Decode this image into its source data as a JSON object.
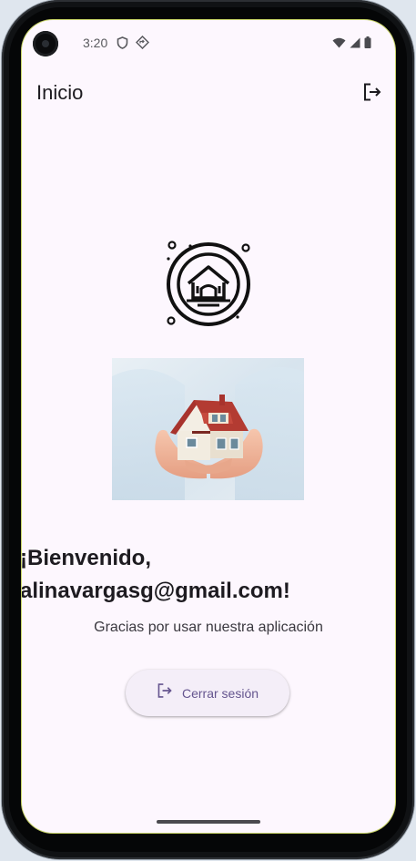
{
  "status_bar": {
    "time": "3:20"
  },
  "app_bar": {
    "title": "Inicio"
  },
  "welcome": {
    "heading": "¡Bienvenido, alinavargasg@gmail.com!",
    "subtitle": "Gracias por usar nuestra aplicación"
  },
  "actions": {
    "sign_out_label": "Cerrar sesión"
  },
  "colors": {
    "screen_background": "#fdf7fe",
    "primary": "#65558f",
    "button_background": "#f4eef8",
    "text": "#1d1b20"
  },
  "icons": {
    "status_left": [
      "shield-icon",
      "location-icon"
    ],
    "status_right": [
      "wifi-icon",
      "signal-icon",
      "battery-icon"
    ],
    "app_bar_action": "logout-icon",
    "button_icon": "logout-icon",
    "logo": "house-emblem-icon"
  }
}
